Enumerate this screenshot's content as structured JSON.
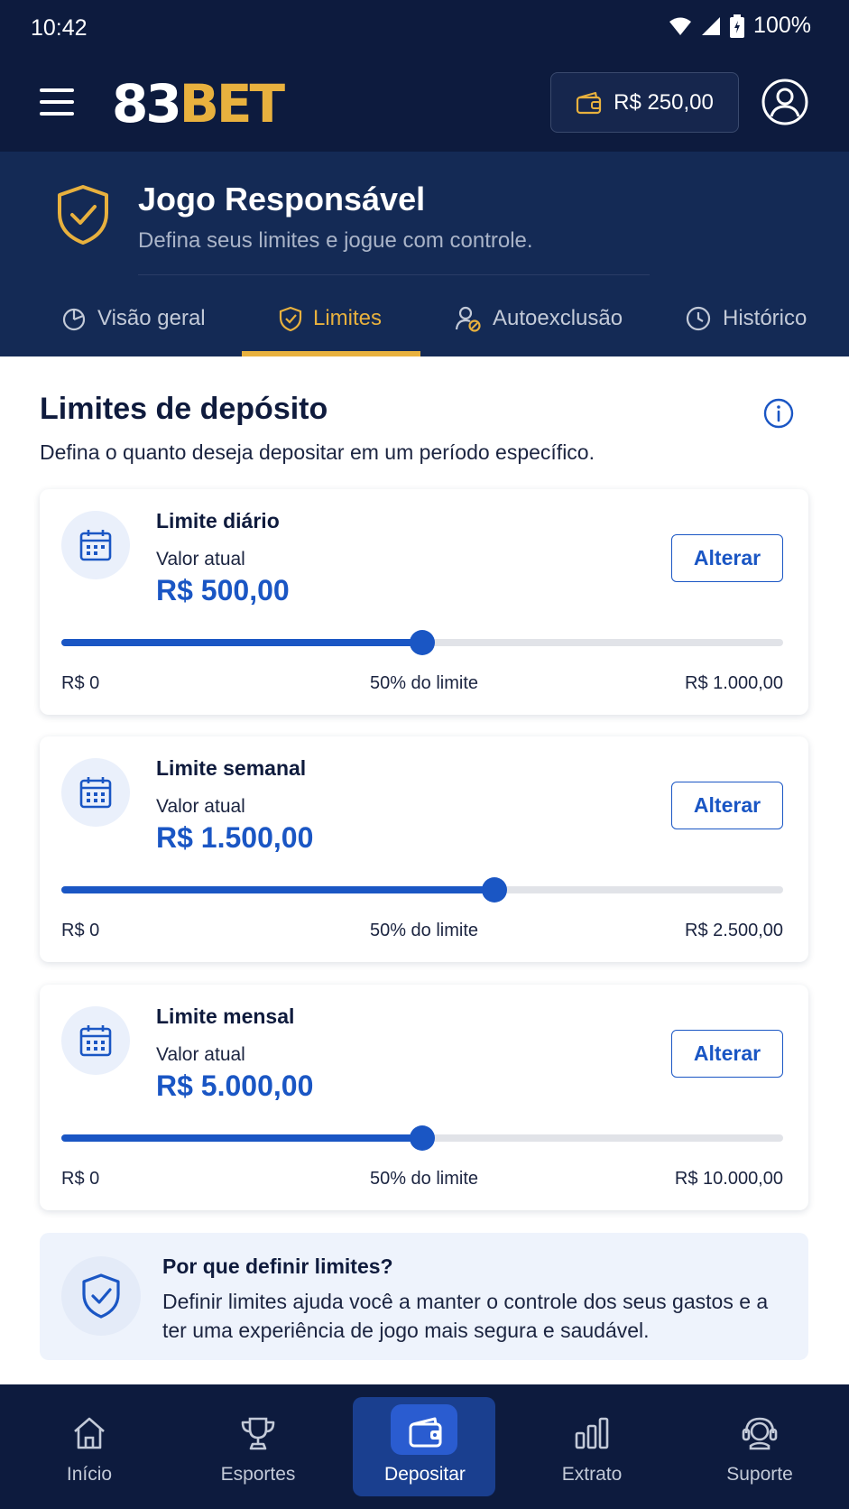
{
  "status_bar": {
    "time": "10:42",
    "battery": "100%"
  },
  "header": {
    "logo_number": "83",
    "logo_brand": "BET",
    "balance": "R$ 250,00"
  },
  "hero": {
    "title": "Jogo Responsável",
    "subtitle": "Defina seus limites e jogue com controle."
  },
  "tabs": [
    {
      "label": "Visão geral",
      "icon": "chart-pie-icon",
      "active": false
    },
    {
      "label": "Limites",
      "icon": "shield-check-icon",
      "active": true
    },
    {
      "label": "Autoexclusão",
      "icon": "user-lock-icon",
      "active": false
    },
    {
      "label": "Histórico",
      "icon": "clock-icon",
      "active": false
    }
  ],
  "section": {
    "title": "Limites de depósito",
    "subtitle": "Defina o quanto deseja depositar em um período específico."
  },
  "limits": [
    {
      "title": "Limite diário",
      "value_label": "Valor atual",
      "value": "R$ 500,00",
      "button": "Alterar",
      "min_label": "R$ 0",
      "mid_label": "50% do limite",
      "max_label": "R$ 1.000,00",
      "fraction": 0.5
    },
    {
      "title": "Limite semanal",
      "value_label": "Valor atual",
      "value": "R$ 1.500,00",
      "button": "Alterar",
      "min_label": "R$ 0",
      "mid_label": "50% do limite",
      "max_label": "R$ 2.500,00",
      "fraction": 0.6
    },
    {
      "title": "Limite mensal",
      "value_label": "Valor atual",
      "value": "R$ 5.000,00",
      "button": "Alterar",
      "min_label": "R$ 0",
      "mid_label": "50% do limite",
      "max_label": "R$ 10.000,00",
      "fraction": 0.5
    }
  ],
  "info_box": {
    "title": "Por que definir limites?",
    "text": "Definir limites ajuda você a manter o controle dos seus gastos e a ter uma experiência de jogo mais segura e saudável."
  },
  "bottom_nav": [
    {
      "label": "Início",
      "icon": "home-icon",
      "active": false
    },
    {
      "label": "Esportes",
      "icon": "trophy-icon",
      "active": false
    },
    {
      "label": "Depositar",
      "icon": "wallet-icon",
      "active": true
    },
    {
      "label": "Extrato",
      "icon": "bar-chart-icon",
      "active": false
    },
    {
      "label": "Suporte",
      "icon": "headset-icon",
      "active": false
    }
  ],
  "colors": {
    "navy": "#0d1b3e",
    "hero": "#142a55",
    "accent_gold": "#e8b13e",
    "primary_blue": "#1a56c4"
  }
}
